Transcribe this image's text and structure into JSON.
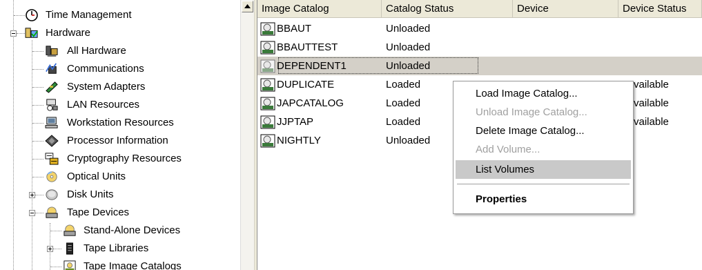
{
  "tree": {
    "items": [
      {
        "label": "Time Management",
        "icon": "clock-icon"
      },
      {
        "label": "Hardware",
        "icon": "hardware-icon"
      },
      {
        "label": "All Hardware",
        "icon": "all-hardware-icon"
      },
      {
        "label": "Communications",
        "icon": "communications-icon"
      },
      {
        "label": "System Adapters",
        "icon": "system-adapters-icon"
      },
      {
        "label": "LAN Resources",
        "icon": "lan-resources-icon"
      },
      {
        "label": "Workstation Resources",
        "icon": "workstation-icon"
      },
      {
        "label": "Processor Information",
        "icon": "processor-icon"
      },
      {
        "label": "Cryptography Resources",
        "icon": "cryptography-icon"
      },
      {
        "label": "Optical Units",
        "icon": "optical-units-icon"
      },
      {
        "label": "Disk Units",
        "icon": "disk-units-icon"
      },
      {
        "label": "Tape Devices",
        "icon": "tape-devices-icon"
      },
      {
        "label": "Stand-Alone Devices",
        "icon": "stand-alone-devices-icon"
      },
      {
        "label": "Tape Libraries",
        "icon": "tape-libraries-icon"
      },
      {
        "label": "Tape Image Catalogs",
        "icon": "tape-image-catalogs-icon"
      }
    ]
  },
  "list": {
    "columns": [
      "Image Catalog",
      "Catalog Status",
      "Device",
      "Device Status"
    ],
    "rows": [
      {
        "name": "BBAUT",
        "status": "Unloaded",
        "device": "",
        "device_status": ""
      },
      {
        "name": "BBAUTTEST",
        "status": "Unloaded",
        "device": "",
        "device_status": ""
      },
      {
        "name": "DEPENDENT1",
        "status": "Unloaded",
        "device": "",
        "device_status": ""
      },
      {
        "name": "DUPLICATE",
        "status": "Loaded",
        "device": "",
        "device_status": "vailable"
      },
      {
        "name": "JAPCATALOG",
        "status": "Loaded",
        "device": "",
        "device_status": "vailable"
      },
      {
        "name": "JJPTAP",
        "status": "Loaded",
        "device": "",
        "device_status": "vailable"
      },
      {
        "name": "NIGHTLY",
        "status": "Unloaded",
        "device": "",
        "device_status": ""
      }
    ],
    "selected_index": 2
  },
  "context_menu": {
    "items": [
      {
        "label": "Load Image Catalog...",
        "enabled": true
      },
      {
        "label": "Unload Image Catalog...",
        "enabled": false
      },
      {
        "label": "Delete Image Catalog...",
        "enabled": true
      },
      {
        "label": "Add Volume...",
        "enabled": false
      },
      {
        "label": "List Volumes",
        "enabled": true,
        "highlighted": true
      },
      {
        "label": "Properties",
        "enabled": true,
        "default": true
      }
    ]
  },
  "colors": {
    "header_bg": "#ece9d8",
    "selection_bg": "#d4d0c8",
    "menu_highlight": "#c9c9c9",
    "disabled_text": "#a0a0a0"
  }
}
